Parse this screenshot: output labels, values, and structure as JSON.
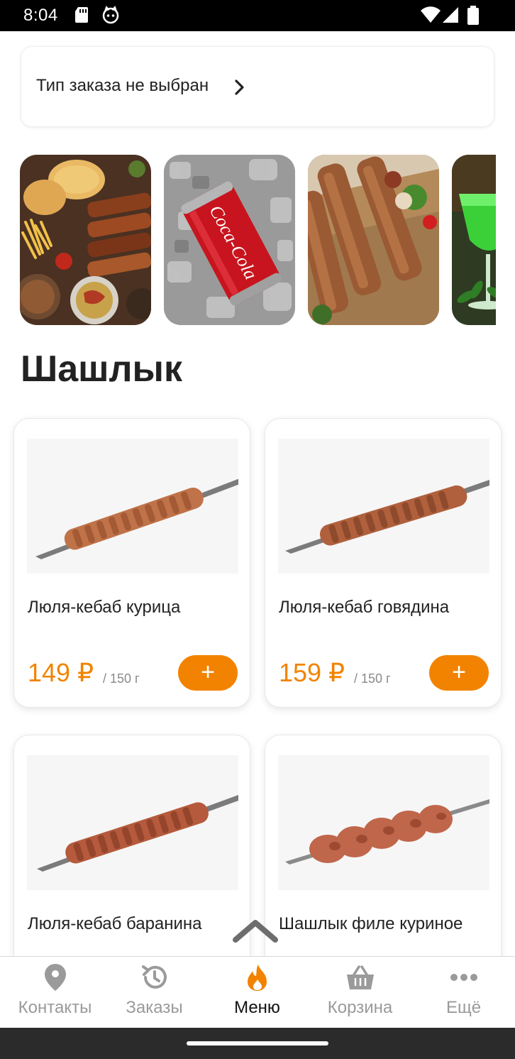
{
  "status_bar": {
    "time": "8:04"
  },
  "order_type": {
    "label": "Тип заказа не выбран"
  },
  "section": {
    "title": "Шашлык"
  },
  "products": [
    {
      "name": "Люля-кебаб курица",
      "price": "149 ₽",
      "weight": "/ 150 г",
      "add_label": "+"
    },
    {
      "name": "Люля-кебаб говядина",
      "price": "159 ₽",
      "weight": "/ 150 г",
      "add_label": "+"
    },
    {
      "name": "Люля-кебаб баранина"
    },
    {
      "name": "Шашлык филе куриное"
    }
  ],
  "nav": {
    "items": [
      {
        "label": "Контакты",
        "icon": "location-pin-icon"
      },
      {
        "label": "Заказы",
        "icon": "history-icon"
      },
      {
        "label": "Меню",
        "icon": "flame-icon",
        "active": true
      },
      {
        "label": "Корзина",
        "icon": "basket-icon"
      },
      {
        "label": "Ещё",
        "icon": "more-dots-icon"
      }
    ]
  },
  "colors": {
    "accent": "#f28300",
    "text": "#222222",
    "muted": "#9a9a9a"
  }
}
